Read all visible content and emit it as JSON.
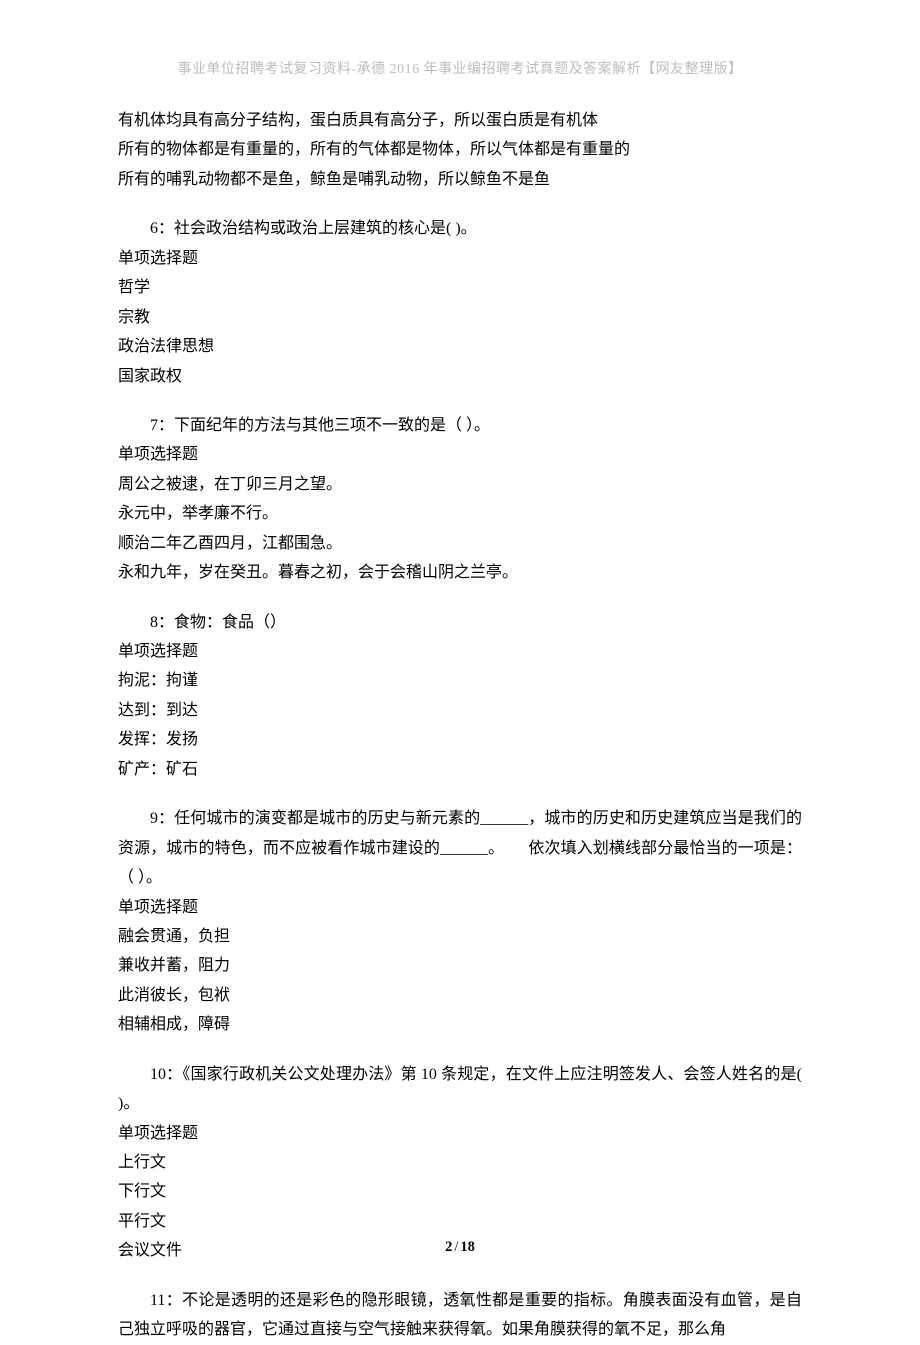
{
  "header": "事业单位招聘考试复习资料-承德 2016 年事业编招聘考试真题及答案解析【网友整理版】",
  "preamble": {
    "l1": "有机体均具有高分子结构，蛋白质具有高分子，所以蛋白质是有机体",
    "l2": "所有的物体都是有重量的，所有的气体都是物体，所以气体都是有重量的",
    "l3": "所有的哺乳动物都不是鱼，鲸鱼是哺乳动物，所以鲸鱼不是鱼"
  },
  "q6": {
    "stem": "6：社会政治结构或政治上层建筑的核心是( )。",
    "type": "单项选择题",
    "opts": [
      "哲学",
      "宗教",
      "政治法律思想",
      "国家政权"
    ]
  },
  "q7": {
    "stem": "7：下面纪年的方法与其他三项不一致的是（ ）。",
    "type": "单项选择题",
    "opts": [
      "周公之被逮，在丁卯三月之望。",
      "永元中，举孝廉不行。",
      "顺治二年乙酉四月，江都围急。",
      "永和九年，岁在癸丑。暮春之初，会于会稽山阴之兰亭。"
    ]
  },
  "q8": {
    "stem": "8：食物：食品（）",
    "type": "单项选择题",
    "opts": [
      "拘泥：拘谨",
      "达到：到达",
      "发挥：发扬",
      "矿产：矿石"
    ]
  },
  "q9": {
    "stem": "9：任何城市的演变都是城市的历史与新元素的______，城市的历史和历史建筑应当是我们的资源，城市的特色，而不应被看作城市建设的______。　　依次填入划横线部分最恰当的一项是：（ ）。",
    "type": "单项选择题",
    "opts": [
      "融会贯通，负担",
      "兼收并蓄，阻力",
      "此消彼长，包袱",
      "相辅相成，障碍"
    ]
  },
  "q10": {
    "stem": "10：《国家行政机关公文处理办法》第 10 条规定，在文件上应注明签发人、会签人姓名的是( )。",
    "type": "单项选择题",
    "opts": [
      "上行文",
      "下行文",
      "平行文",
      "会议文件"
    ]
  },
  "q11": {
    "stem": "11：不论是透明的还是彩色的隐形眼镜，透氧性都是重要的指标。角膜表面没有血管，是自己独立呼吸的器官，它通过直接与空气接触来获得氧。如果角膜获得的氧不足，那么角"
  },
  "pager": {
    "current": "2",
    "sep": "/",
    "total": "18"
  }
}
